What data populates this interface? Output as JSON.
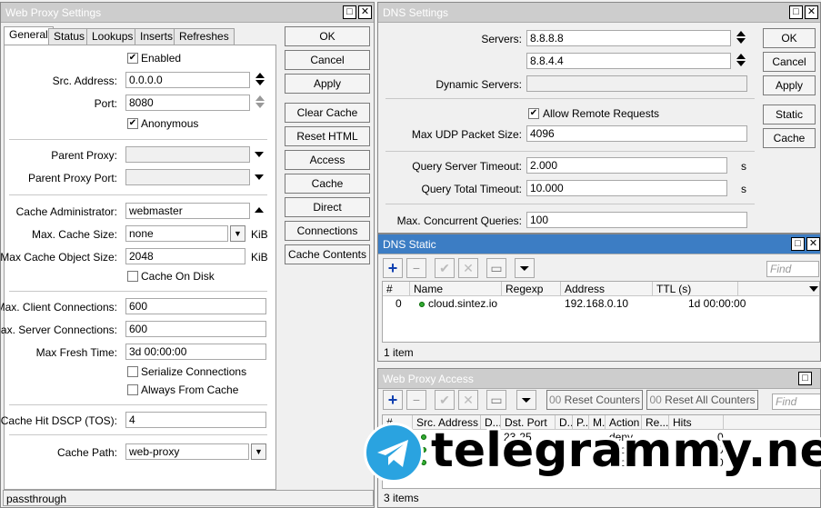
{
  "web_proxy": {
    "title": "Web Proxy Settings",
    "tabs": [
      "General",
      "Status",
      "Lookups",
      "Inserts",
      "Refreshes"
    ],
    "enabled_label": "Enabled",
    "src_address_label": "Src. Address:",
    "src_address": "0.0.0.0",
    "port_label": "Port:",
    "port": "8080",
    "anonymous_label": "Anonymous",
    "parent_proxy_label": "Parent Proxy:",
    "parent_proxy_port_label": "Parent Proxy Port:",
    "cache_admin_label": "Cache Administrator:",
    "cache_admin": "webmaster",
    "max_cache_size_label": "Max. Cache Size:",
    "max_cache_size": "none",
    "max_cache_obj_label": "Max Cache Object Size:",
    "max_cache_obj": "2048",
    "kib": "KiB",
    "cache_on_disk_label": "Cache On Disk",
    "max_client_conn_label": "Max. Client Connections:",
    "max_client_conn": "600",
    "max_server_conn_label": "Max. Server Connections:",
    "max_server_conn": "600",
    "max_fresh_time_label": "Max Fresh Time:",
    "max_fresh_time": "3d 00:00:00",
    "serialize_label": "Serialize Connections",
    "always_cache_label": "Always From Cache",
    "dscp_label": "Cache Hit DSCP (TOS):",
    "dscp": "4",
    "cache_path_label": "Cache Path:",
    "cache_path": "web-proxy",
    "status_bar": "passthrough",
    "buttons": [
      "OK",
      "Cancel",
      "Apply",
      "Clear Cache",
      "Reset HTML",
      "Access",
      "Cache",
      "Direct",
      "Connections",
      "Cache Contents"
    ]
  },
  "dns": {
    "title": "DNS Settings",
    "servers_label": "Servers:",
    "server1": "8.8.8.8",
    "server2": "8.8.4.4",
    "dynamic_servers_label": "Dynamic Servers:",
    "allow_remote_label": "Allow Remote Requests",
    "max_udp_label": "Max UDP Packet Size:",
    "max_udp": "4096",
    "query_server_timeout_label": "Query Server Timeout:",
    "query_server_timeout": "2.000",
    "query_total_timeout_label": "Query Total Timeout:",
    "query_total_timeout": "10.000",
    "unit_s": "s",
    "max_concurrent_label": "Max. Concurrent Queries:",
    "max_concurrent": "100",
    "buttons": [
      "OK",
      "Cancel",
      "Apply",
      "Static",
      "Cache"
    ]
  },
  "dns_static": {
    "title": "DNS Static",
    "find_placeholder": "Find",
    "columns": [
      "#",
      "Name",
      "Regexp",
      "Address",
      "TTL (s)"
    ],
    "rows": [
      {
        "num": "0",
        "name": "cloud.sintez.io",
        "regexp": "",
        "address": "192.168.0.10",
        "ttl": "1d 00:00:00"
      }
    ],
    "status": "1 item"
  },
  "proxy_access": {
    "title": "Web Proxy Access",
    "find_placeholder": "Find",
    "reset_counters": "Reset Counters",
    "reset_all_counters": "Reset All Counters",
    "counter_prefix": "00",
    "columns": [
      "#",
      "Src. Address",
      "D...",
      "Dst. Port",
      "D...",
      "P...",
      "M...",
      "Action",
      "Re...",
      "Hits"
    ],
    "rows": [
      {
        "dst_port": "23-25",
        "action": "deny",
        "hits": "0"
      },
      {
        "dst_port": "",
        "action": "allow",
        "hits": "0"
      },
      {
        "dst_port": "",
        "action": "allow",
        "hits": "0"
      }
    ],
    "status": "3 items"
  },
  "watermark": "telegrammy.net"
}
